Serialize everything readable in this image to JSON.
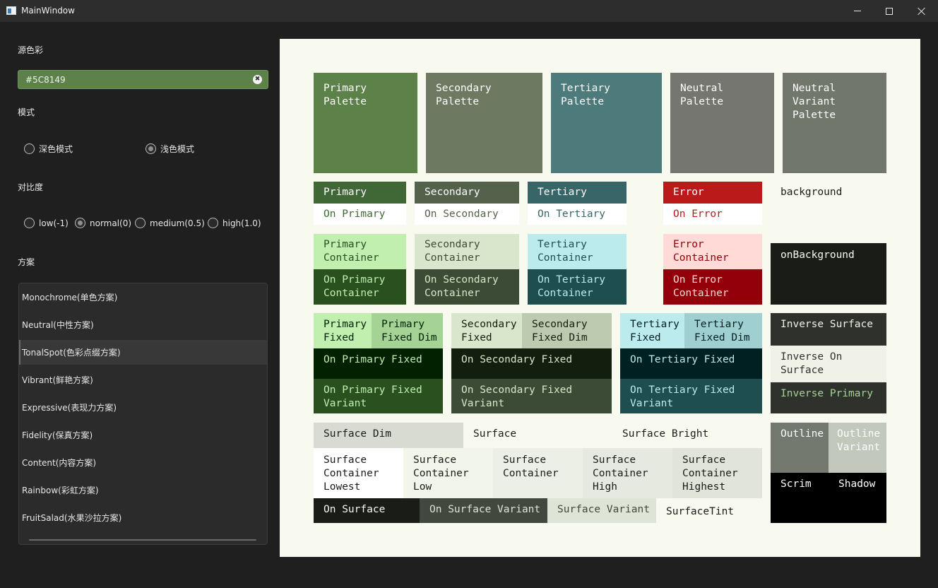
{
  "window": {
    "title": "MainWindow",
    "minimize_glyph": "",
    "maximize_glyph": "",
    "close_glyph": ""
  },
  "sidebar": {
    "source_color_label": "源色彩",
    "source_color_value": "#5C8149",
    "clear_glyph": "✖",
    "mode_label": "模式",
    "modes": [
      {
        "label": "深色模式",
        "checked": false
      },
      {
        "label": "浅色模式",
        "checked": true
      }
    ],
    "contrast_label": "对比度",
    "contrasts": [
      {
        "label": "low(-1)",
        "checked": false
      },
      {
        "label": "normal(0)",
        "checked": true
      },
      {
        "label": "medium(0.5)",
        "checked": false
      },
      {
        "label": "high(1.0)",
        "checked": false
      }
    ],
    "scheme_label": "方案",
    "schemes": [
      {
        "label": "Monochrome(单色方案)",
        "selected": false
      },
      {
        "label": "Neutral(中性方案)",
        "selected": false
      },
      {
        "label": "TonalSpot(色彩点缀方案)",
        "selected": true
      },
      {
        "label": "Vibrant(鲜艳方案)",
        "selected": false
      },
      {
        "label": "Expressive(表现力方案)",
        "selected": false
      },
      {
        "label": "Fidelity(保真方案)",
        "selected": false
      },
      {
        "label": "Content(内容方案)",
        "selected": false
      },
      {
        "label": "Rainbow(彩虹方案)",
        "selected": false
      },
      {
        "label": "FruitSalad(水果沙拉方案)",
        "selected": false
      }
    ]
  },
  "swatches": {
    "primary_palette": {
      "label": "Primary\nPalette",
      "bg": "#5c8149",
      "fg": "#ffffff"
    },
    "secondary_palette": {
      "label": "Secondary\nPalette",
      "bg": "#6d7a61",
      "fg": "#ffffff"
    },
    "tertiary_palette": {
      "label": "Tertiary\nPalette",
      "bg": "#4d7b7c",
      "fg": "#ffffff"
    },
    "neutral_palette": {
      "label": "Neutral\nPalette",
      "bg": "#74766f",
      "fg": "#ffffff"
    },
    "neutral_variant_palette": {
      "label": "Neutral\nVariant\nPalette",
      "bg": "#72776c",
      "fg": "#ffffff"
    },
    "primary": {
      "label": "Primary",
      "bg": "#406836",
      "fg": "#ffffff"
    },
    "on_primary": {
      "label": "On Primary",
      "bg": "#ffffff",
      "fg": "#406836"
    },
    "secondary": {
      "label": "Secondary",
      "bg": "#54624c",
      "fg": "#ffffff"
    },
    "on_secondary": {
      "label": "On Secondary",
      "bg": "#ffffff",
      "fg": "#54624c"
    },
    "tertiary": {
      "label": "Tertiary",
      "bg": "#386668",
      "fg": "#ffffff"
    },
    "on_tertiary": {
      "label": "On Tertiary",
      "bg": "#ffffff",
      "fg": "#386668"
    },
    "error": {
      "label": "Error",
      "bg": "#ba1a1a",
      "fg": "#ffffff"
    },
    "on_error": {
      "label": "On Error",
      "bg": "#ffffff",
      "fg": "#ba1a1a"
    },
    "background": {
      "label": "background",
      "bg": "#f8faf0",
      "fg": "#1a1c18"
    },
    "primary_container": {
      "label": "Primary\nContainer",
      "bg": "#c0efb0",
      "fg": "#2a5020"
    },
    "on_primary_container": {
      "label": "On Primary\nContainer",
      "bg": "#2a5020",
      "fg": "#c0efb0"
    },
    "secondary_container": {
      "label": "Secondary\nContainer",
      "bg": "#d8e7cb",
      "fg": "#3c4b35"
    },
    "on_secondary_container": {
      "label": "On Secondary\nContainer",
      "bg": "#3c4b35",
      "fg": "#d8e7cb"
    },
    "tertiary_container": {
      "label": "Tertiary\nContainer",
      "bg": "#bcebed",
      "fg": "#1e4e50"
    },
    "on_tertiary_container": {
      "label": "On Tertiary\nContainer",
      "bg": "#1e4e50",
      "fg": "#bcebed"
    },
    "error_container": {
      "label": "Error\nContainer",
      "bg": "#ffdad6",
      "fg": "#93000a"
    },
    "on_error_container": {
      "label": "On Error\nContainer",
      "bg": "#93000a",
      "fg": "#ffdad6"
    },
    "on_background": {
      "label": "onBackground",
      "bg": "#1a1c18",
      "fg": "#f8faf0"
    },
    "primary_fixed": {
      "label": "Primary\nFixed",
      "bg": "#c0efb0",
      "fg": "#002200"
    },
    "primary_fixed_dim": {
      "label": "Primary\nFixed Dim",
      "bg": "#a5d396",
      "fg": "#002200"
    },
    "on_primary_fixed": {
      "label": "On Primary Fixed",
      "bg": "#022100",
      "fg": "#c0efb0"
    },
    "on_primary_fixed_variant": {
      "label": "On Primary Fixed\nVariant",
      "bg": "#2a5020",
      "fg": "#c0efb0"
    },
    "secondary_fixed": {
      "label": "Secondary\nFixed",
      "bg": "#d8e7cb",
      "fg": "#121f0e"
    },
    "secondary_fixed_dim": {
      "label": "Secondary\nFixed Dim",
      "bg": "#bccbb0",
      "fg": "#121f0e"
    },
    "on_secondary_fixed": {
      "label": "On Secondary Fixed",
      "bg": "#121f0e",
      "fg": "#d8e7cb"
    },
    "on_secondary_fixed_variant": {
      "label": "On Secondary Fixed\nVariant",
      "bg": "#3c4b35",
      "fg": "#d8e7cb"
    },
    "tertiary_fixed": {
      "label": "Tertiary\nFixed",
      "bg": "#bcebed",
      "fg": "#002021"
    },
    "tertiary_fixed_dim": {
      "label": "Tertiary\nFixed Dim",
      "bg": "#a0cfd1",
      "fg": "#002021"
    },
    "on_tertiary_fixed": {
      "label": "On Tertiary Fixed",
      "bg": "#002021",
      "fg": "#bcebed"
    },
    "on_tertiary_fixed_variant": {
      "label": "On Tertiary Fixed\nVariant",
      "bg": "#1e4e50",
      "fg": "#bcebed"
    },
    "inverse_surface": {
      "label": "Inverse Surface",
      "bg": "#2f312d",
      "fg": "#f0f2e8"
    },
    "inverse_on_surface": {
      "label": "Inverse On\nSurface",
      "bg": "#f0f2e8",
      "fg": "#2f312d"
    },
    "inverse_primary": {
      "label": "Inverse Primary",
      "bg": "#2f312d",
      "fg": "#a5d396"
    },
    "surface_dim": {
      "label": "Surface Dim",
      "bg": "#d8dbd1",
      "fg": "#1a1c18"
    },
    "surface": {
      "label": "Surface",
      "bg": "#f8faf0",
      "fg": "#1a1c18"
    },
    "surface_bright": {
      "label": "Surface Bright",
      "bg": "#f8faf0",
      "fg": "#1a1c18"
    },
    "surface_container_lowest": {
      "label": "Surface\nContainer\nLowest",
      "bg": "#ffffff",
      "fg": "#1a1c18"
    },
    "surface_container_low": {
      "label": "Surface\nContainer\nLow",
      "bg": "#f2f5ea",
      "fg": "#1a1c18"
    },
    "surface_container": {
      "label": "Surface\nContainer",
      "bg": "#ecefe5",
      "fg": "#1a1c18"
    },
    "surface_container_high": {
      "label": "Surface\nContainer\nHigh",
      "bg": "#e6e9df",
      "fg": "#1a1c18"
    },
    "surface_container_highest": {
      "label": "Surface\nContainer\nHighest",
      "bg": "#e1e4d9",
      "fg": "#1a1c18"
    },
    "on_surface": {
      "label": "On Surface",
      "bg": "#1a1c18",
      "fg": "#f8faf0"
    },
    "on_surface_variant": {
      "label": "On Surface Variant",
      "bg": "#43483f",
      "fg": "#dee5d6"
    },
    "surface_variant": {
      "label": "Surface Variant",
      "bg": "#dee5d6",
      "fg": "#43483f"
    },
    "surface_tint": {
      "label": "SurfaceTint",
      "bg": "#f8faf0",
      "fg": "#1a1c18"
    },
    "outline": {
      "label": "Outline",
      "bg": "#73796e",
      "fg": "#ffffff"
    },
    "outline_variant": {
      "label": "Outline\nVariant",
      "bg": "#c3c8bc",
      "fg": "#ffffff"
    },
    "scrim": {
      "label": "Scrim",
      "bg": "#000000",
      "fg": "#ffffff"
    },
    "shadow": {
      "label": "Shadow",
      "bg": "#000000",
      "fg": "#ffffff"
    }
  }
}
